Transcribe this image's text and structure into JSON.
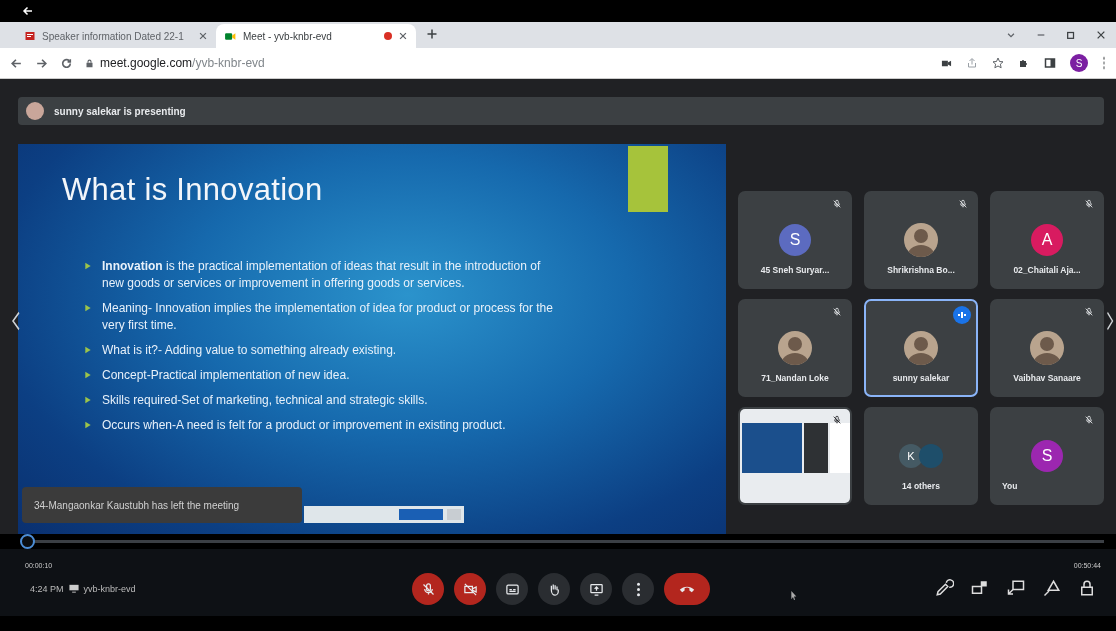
{
  "browser": {
    "tabs": [
      {
        "title": "Speaker information Dated 22-1",
        "selected": false,
        "recording": false
      },
      {
        "title": "Meet - yvb-knbr-evd",
        "selected": true,
        "recording": true
      }
    ],
    "url": {
      "host": "meet.google.com",
      "path": "/yvb-knbr-evd"
    },
    "profile": "S"
  },
  "presenting_banner": "sunny salekar is presenting",
  "slide": {
    "title": "What is Innovation",
    "bullets": [
      "**Innovation** is the practical implementation of ideas that result in the introduction of new goods or services or improvement in offering goods or services.",
      "Meaning- Innovation implies the implementation of idea for product or process for the very first time.",
      "What is it?- Adding value to something already existing.",
      "Concept-Practical implementation of new idea.",
      "Skills required-Set of marketing, technical and strategic skills.",
      "Occurs when-A need is felt for a product or improvement in existing product."
    ]
  },
  "toast": "34-Mangaonkar Kaustubh has left the meeting",
  "tiles": [
    {
      "kind": "initial",
      "name": "45 Sneh Suryar...",
      "initial": "S",
      "color": "#5c6bc0",
      "muted": true,
      "speaking": false
    },
    {
      "kind": "photo",
      "name": "Shrikrishna Bo...",
      "muted": true,
      "speaking": false
    },
    {
      "kind": "initial",
      "name": "02_Chaitali Aja...",
      "initial": "A",
      "color": "#d81b60",
      "muted": true,
      "speaking": false
    },
    {
      "kind": "photo",
      "name": "71_Nandan Loke",
      "muted": true,
      "speaking": false
    },
    {
      "kind": "photo",
      "name": "sunny salekar",
      "muted": false,
      "speaking": true
    },
    {
      "kind": "photo",
      "name": "Vaibhav Sanaare",
      "muted": true,
      "speaking": false
    },
    {
      "kind": "screen",
      "muted": true,
      "speaking": false
    },
    {
      "kind": "others",
      "name": "14 others",
      "initial": "K",
      "muted": false,
      "speaking": false
    },
    {
      "kind": "initial",
      "name": "You",
      "initial": "S",
      "color": "#9c27b0",
      "muted": true,
      "speaking": false
    }
  ],
  "meeting_info": {
    "time": "4:24 PM",
    "code": "yvb-knbr-evd"
  },
  "controls": [
    {
      "kind": "mic",
      "off": true
    },
    {
      "kind": "camera",
      "off": true
    },
    {
      "kind": "captions",
      "off": false
    },
    {
      "kind": "hand",
      "off": false
    },
    {
      "kind": "present",
      "off": false
    },
    {
      "kind": "more",
      "off": false
    },
    {
      "kind": "leave",
      "off": true
    }
  ],
  "player": {
    "elapsed": "00:00:10",
    "total": "00:50:44",
    "level": 0.004
  }
}
